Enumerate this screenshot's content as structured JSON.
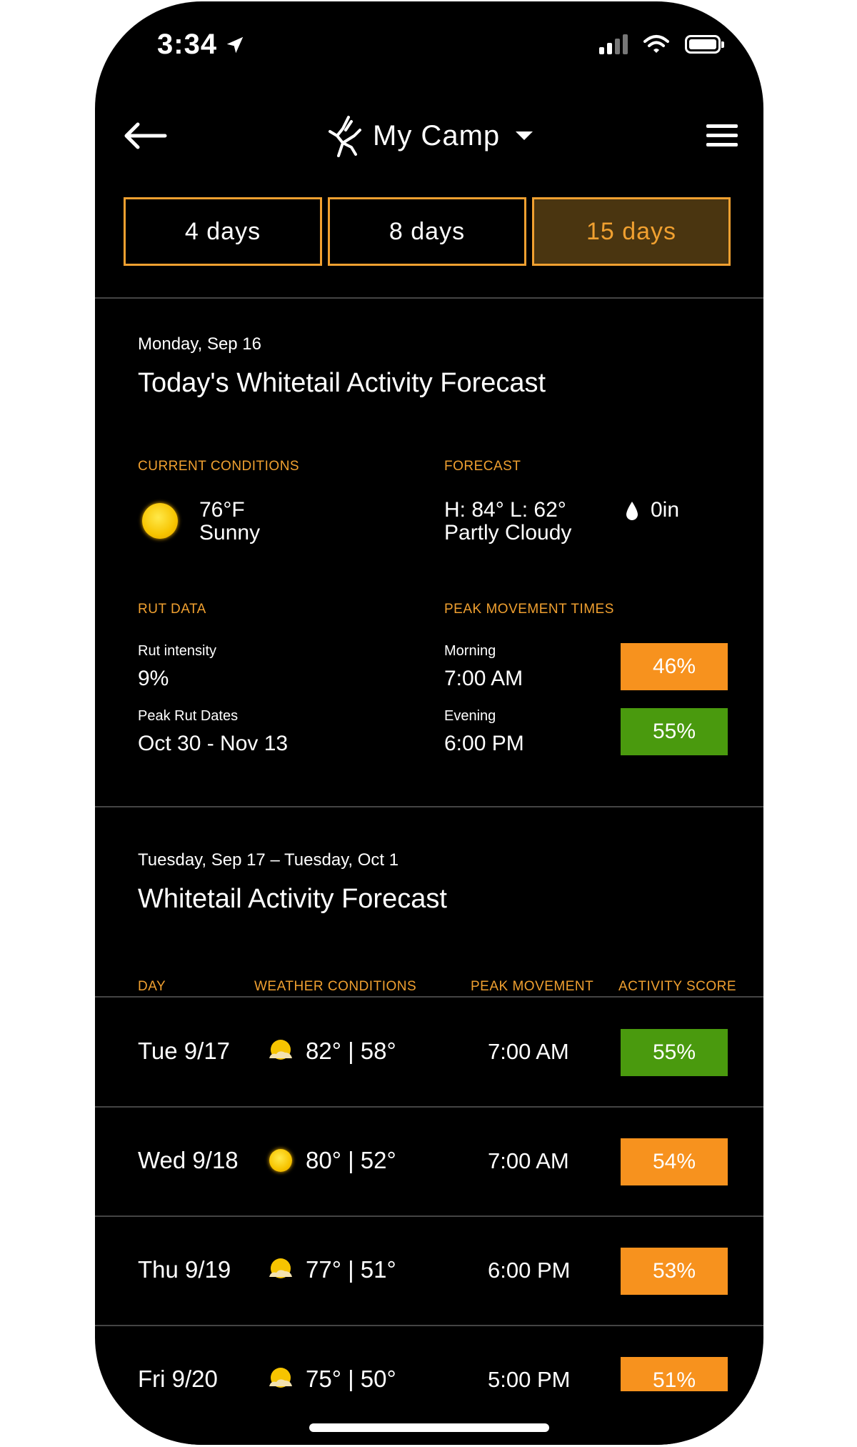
{
  "status_bar": {
    "time": "3:34"
  },
  "nav": {
    "camp_name": "My Camp"
  },
  "tabs": [
    {
      "label": "4 days",
      "active": false
    },
    {
      "label": "8 days",
      "active": false
    },
    {
      "label": "15 days",
      "active": true
    }
  ],
  "today": {
    "date": "Monday, Sep 16",
    "title": "Today's Whitetail Activity Forecast",
    "current_conditions": {
      "label": "CURRENT CONDITIONS",
      "temp": "76°F",
      "condition": "Sunny",
      "icon": "sun-icon"
    },
    "forecast": {
      "label": "FORECAST",
      "high_low": "H: 84° L: 62°",
      "condition": "Partly Cloudy",
      "precip": "0in",
      "precip_icon": "raindrop-icon"
    },
    "rut_data": {
      "label": "RUT DATA",
      "intensity_label": "Rut intensity",
      "intensity_value": "9%",
      "peak_label": "Peak Rut Dates",
      "peak_value": "Oct 30 - Nov 13"
    },
    "peak_movement": {
      "label": "PEAK MOVEMENT TIMES",
      "morning_label": "Morning",
      "morning_time": "7:00 AM",
      "morning_score": "46%",
      "evening_label": "Evening",
      "evening_time": "6:00 PM",
      "evening_score": "55%"
    }
  },
  "extended": {
    "date_range": "Tuesday, Sep 17 – Tuesday, Oct 1",
    "title": "Whitetail Activity Forecast",
    "columns": {
      "day": "DAY",
      "weather": "WEATHER CONDITIONS",
      "peak": "PEAK MOVEMENT",
      "score": "ACTIVITY SCORE"
    },
    "rows": [
      {
        "day": "Tue 9/17",
        "temps": "82° | 58°",
        "peak": "7:00 AM",
        "score": "55%",
        "score_color": "#4a9a0e",
        "icon": "partly-cloudy-icon"
      },
      {
        "day": "Wed 9/18",
        "temps": "80° | 52°",
        "peak": "7:00 AM",
        "score": "54%",
        "score_color": "#f7921e",
        "icon": "sun-icon"
      },
      {
        "day": "Thu 9/19",
        "temps": "77° | 51°",
        "peak": "6:00 PM",
        "score": "53%",
        "score_color": "#f7921e",
        "icon": "partly-cloudy-icon"
      },
      {
        "day": "Fri 9/20",
        "temps": "75° | 50°",
        "peak": "5:00 PM",
        "score": "51%",
        "score_color": "#f7921e",
        "icon": "partly-cloudy-icon"
      }
    ]
  },
  "colors": {
    "accent": "#f0a030",
    "orange_badge": "#f7921e",
    "green_badge": "#4a9a0e",
    "background": "#000000"
  }
}
